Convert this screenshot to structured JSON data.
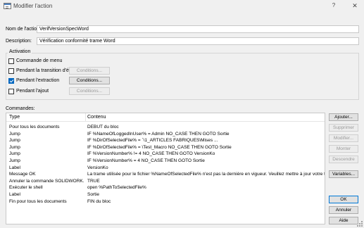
{
  "window": {
    "title": "Modifier l'action",
    "help_glyph": "?",
    "close_glyph": "✕"
  },
  "form": {
    "name_label": "Nom de l'action:",
    "name_value": "VerifVersionSpecWord",
    "description_label": "Description:",
    "description_value": "Vérification conformité trame Word"
  },
  "activation": {
    "title": "Activation",
    "items": [
      {
        "label": "Commande de menu",
        "checked": false,
        "conditions": null
      },
      {
        "label": "Pendant la transition d'état",
        "checked": false,
        "conditions": "Conditions...",
        "conditions_enabled": false
      },
      {
        "label": "Pendant l'extraction",
        "checked": true,
        "conditions": "Conditions...",
        "conditions_enabled": true
      },
      {
        "label": "Pendant l'ajout",
        "checked": false,
        "conditions": "Conditions...",
        "conditions_enabled": false
      }
    ]
  },
  "commands": {
    "label": "Commandes:",
    "headers": [
      "Type",
      "Contenu"
    ],
    "rows": [
      {
        "type": "Pour tous les documents",
        "content": "DEBUT du bloc"
      },
      {
        "type": "Jump",
        "content": "IF %NameOfLoggedInUser% = Admin NO_CASE THEN GOTO Sortie"
      },
      {
        "type": "Jump",
        "content": "IF %DirOfSelectedFile% =                                                         `\\1_ARTICLES FABRIQUES\\Mises ..."
      },
      {
        "type": "Jump",
        "content": "IF %DirOfSelectedFile% =                                                          \\Test_Macro NO_CASE THEN GOTO Sortie"
      },
      {
        "type": "Jump",
        "content": "IF %VersionNumber% != 4 NO_CASE THEN GOTO VersionKo"
      },
      {
        "type": "Jump",
        "content": "IF %VersionNumber% = 4 NO_CASE THEN GOTO Sortie"
      },
      {
        "type": "Label",
        "content": "VersionKo"
      },
      {
        "type": "Message OK",
        "content": "La trame utilisée pour le fichier %NameOfSelectedFile% n'est pas la dernière en vigueur.  Veuillez mettre à jour votre trame p..."
      },
      {
        "type": "Annuler la commande SOLIDWORK...",
        "content": "TRUE"
      },
      {
        "type": "Exécuter le shell",
        "content": "open %PathToSelectedFile%"
      },
      {
        "type": "Label",
        "content": "Sortie"
      },
      {
        "type": "Fin pour tous les documents",
        "content": "FIN du bloc"
      }
    ]
  },
  "side_buttons": [
    {
      "label": "Ajouter...",
      "enabled": true
    },
    {
      "label": "Supprimer",
      "enabled": false
    },
    {
      "label": "Modifier...",
      "enabled": false
    },
    {
      "label": "Monter",
      "enabled": false
    },
    {
      "label": "Descendre",
      "enabled": false
    },
    {
      "label": "Variables...",
      "enabled": true
    }
  ],
  "dialog_buttons": {
    "ok": "OK",
    "cancel": "Annuler",
    "help": "Aide"
  }
}
